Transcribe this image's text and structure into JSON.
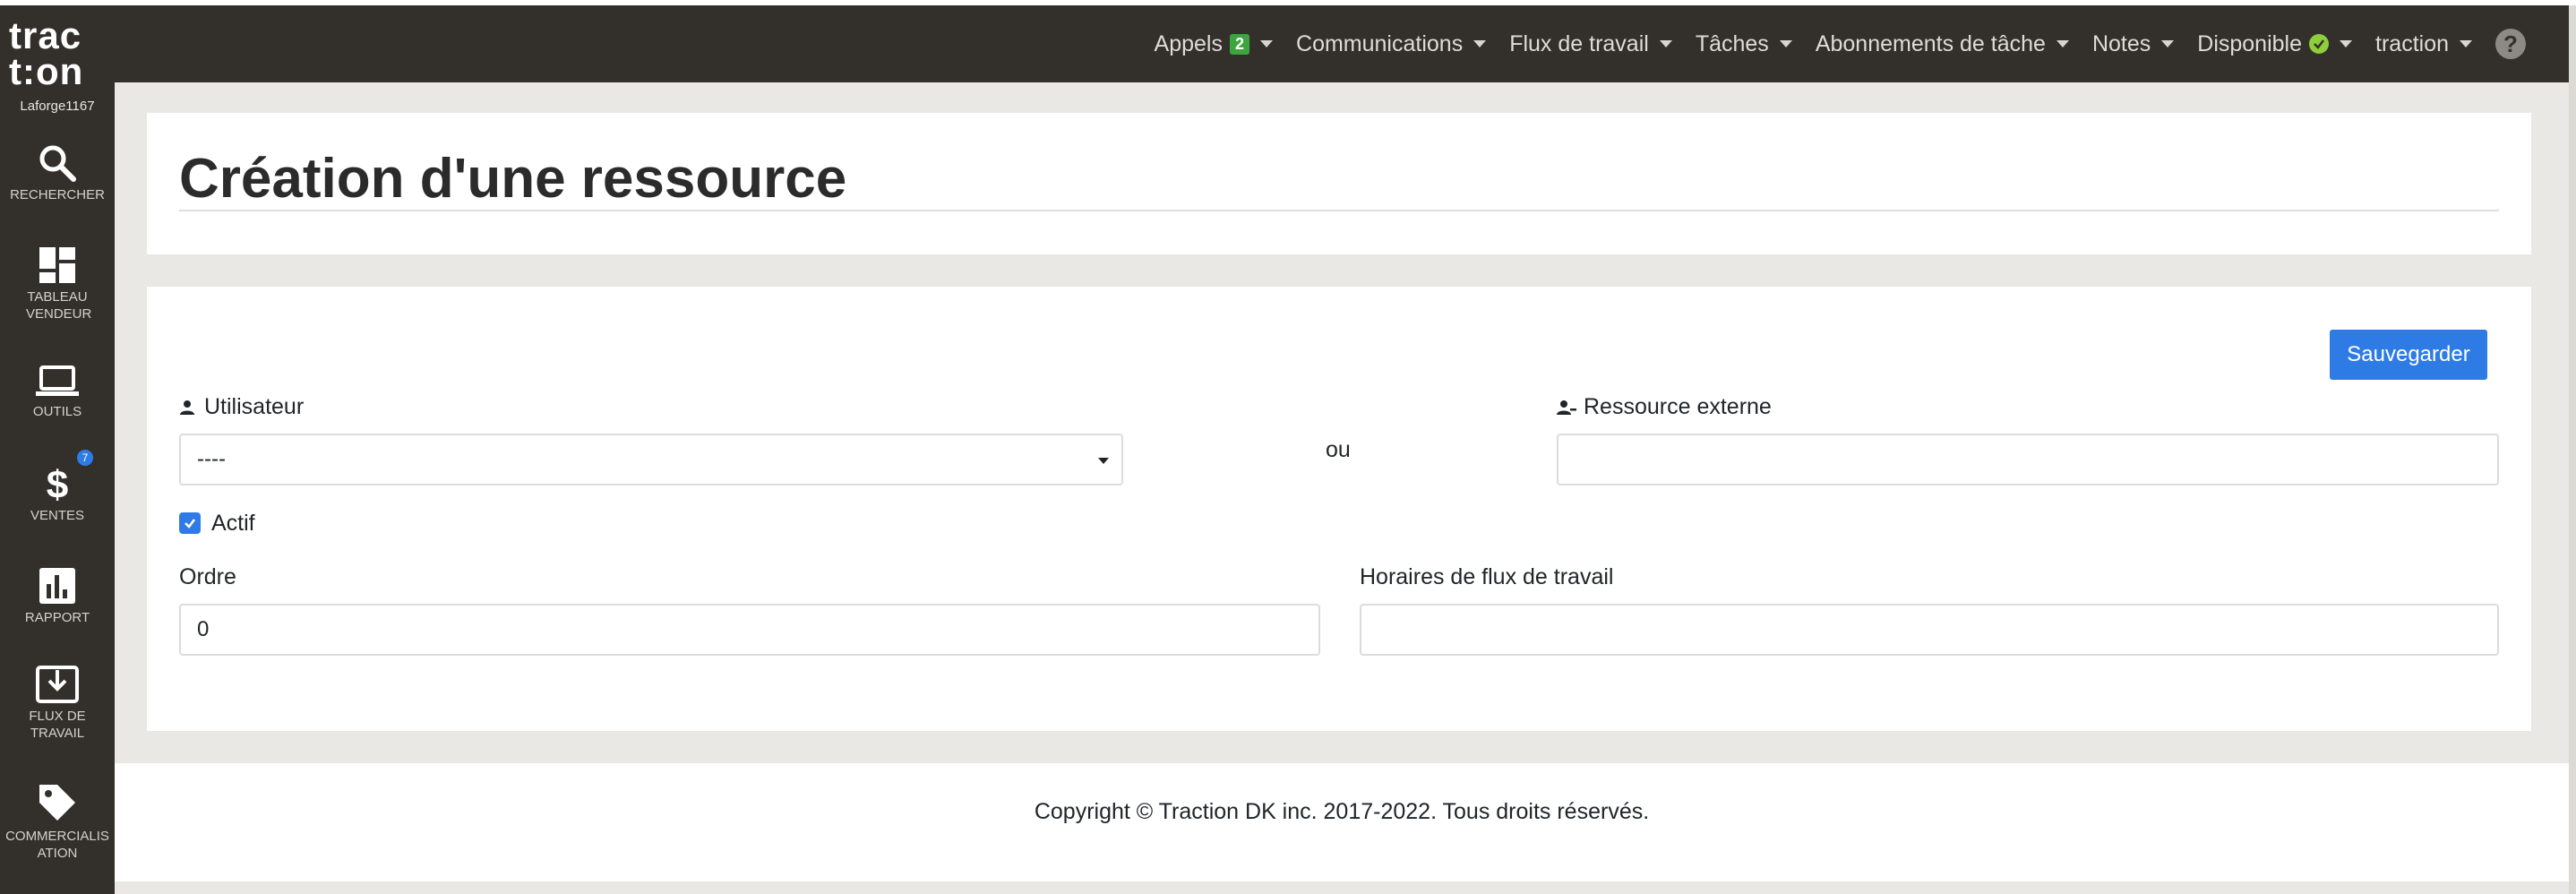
{
  "brand": {
    "logo_line1": "trac",
    "logo_line2": "t:on",
    "username": "Laforge1167"
  },
  "sidebar": {
    "items": [
      {
        "label": "RECHERCHER",
        "icon": "search-icon"
      },
      {
        "label": "TABLEAU VENDEUR",
        "icon": "dashboard-icon"
      },
      {
        "label": "OUTILS",
        "icon": "laptop-icon"
      },
      {
        "label": "VENTES",
        "icon": "dollar-icon",
        "badge": "7"
      },
      {
        "label": "RAPPORT",
        "icon": "bar-chart-icon"
      },
      {
        "label": "FLUX DE TRAVAIL",
        "icon": "download-tray-icon"
      },
      {
        "label": "COMMERCIALISATION",
        "icon": "tag-icon"
      }
    ]
  },
  "navbar": {
    "items": [
      {
        "label": "Appels",
        "badge": "2"
      },
      {
        "label": "Communications"
      },
      {
        "label": "Flux de travail"
      },
      {
        "label": "Tâches"
      },
      {
        "label": "Abonnements de tâche"
      },
      {
        "label": "Notes"
      },
      {
        "label": "Disponible",
        "status_icon": "check-circle-icon"
      },
      {
        "label": "traction"
      }
    ],
    "help": "?"
  },
  "page": {
    "title": "Création d'une ressource"
  },
  "form": {
    "save_label": "Sauvegarder",
    "user_label": "Utilisateur",
    "user_value": "----",
    "or_label": "ou",
    "external_label": "Ressource externe",
    "external_value": "",
    "active_label": "Actif",
    "active_checked": true,
    "order_label": "Ordre",
    "order_value": "0",
    "schedule_label": "Horaires de flux de travail",
    "schedule_value": ""
  },
  "footer": {
    "text": "Copyright © Traction DK inc. 2017-2022. Tous droits réservés."
  },
  "colors": {
    "primary": "#2f7be6",
    "nav_bg": "#33302c",
    "badge_green": "#3da53d",
    "status_green": "#8fce3b"
  }
}
